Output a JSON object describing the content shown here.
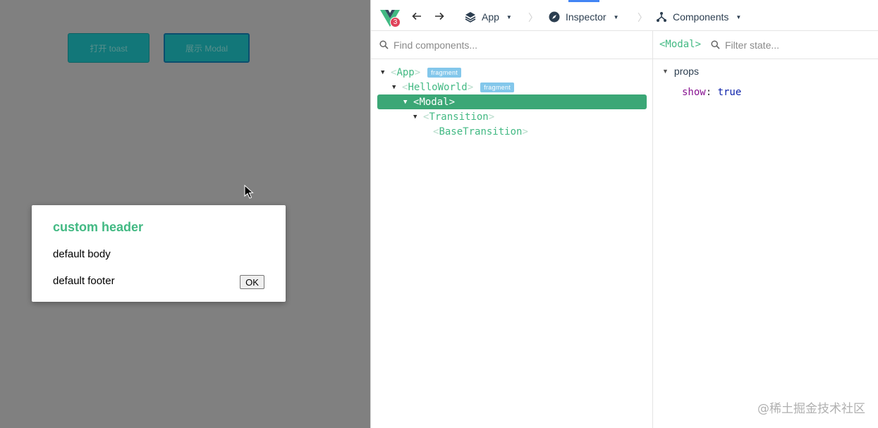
{
  "app": {
    "toast_button": "打开 toast",
    "modal_button": "展示 Modal",
    "modal": {
      "header": "custom header",
      "body": "default body",
      "footer": "default footer",
      "ok_label": "OK"
    }
  },
  "devtools": {
    "version_badge": "3",
    "toolbar": {
      "app_label": "App",
      "inspector_label": "Inspector",
      "components_label": "Components"
    },
    "component_search": {
      "placeholder": "Find components..."
    },
    "tree": [
      {
        "name": "App",
        "tag": "fragment"
      },
      {
        "name": "HelloWorld",
        "tag": "fragment"
      },
      {
        "name": "Modal",
        "selected": true
      },
      {
        "name": "Transition"
      },
      {
        "name": "BaseTransition"
      }
    ],
    "state": {
      "selected_component": "<Modal>",
      "filter_placeholder": "Filter state...",
      "section": "props",
      "props": [
        {
          "key": "show",
          "value": "true"
        }
      ]
    }
  },
  "watermark": "@稀土掘金技术社区",
  "colors": {
    "vue_green": "#42b983",
    "selected_row": "#3ba776",
    "fragment_tag": "#83c7eb",
    "badge_red": "#e0425a"
  }
}
